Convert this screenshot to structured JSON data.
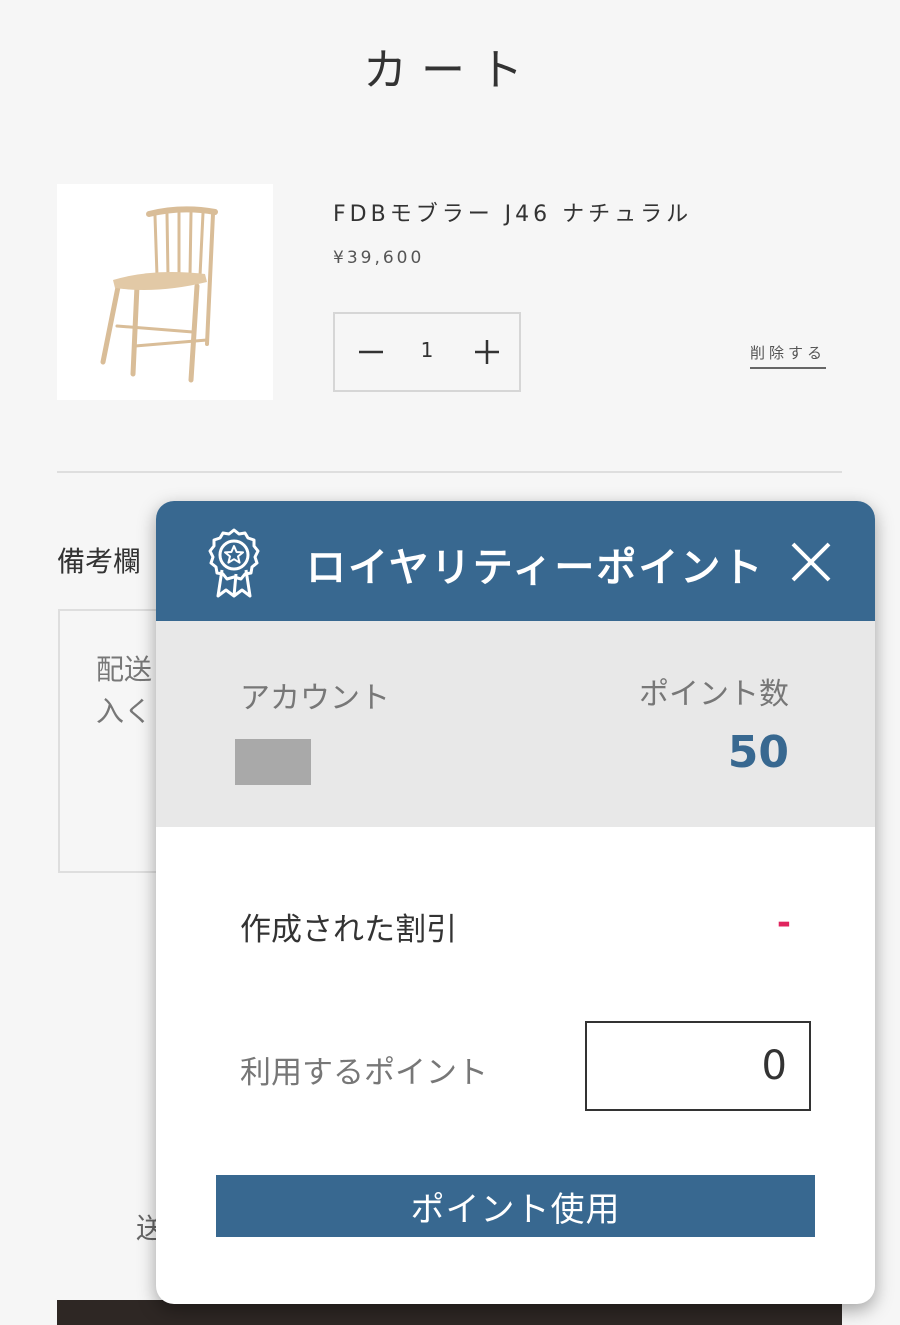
{
  "page": {
    "title": "カート"
  },
  "cart_item": {
    "name": "FDBモブラー J46 ナチュラル",
    "price": "¥39,600",
    "quantity": "1",
    "remove_label": "削除する",
    "image_icon": "chair-image"
  },
  "notes": {
    "label": "備考欄",
    "placeholder": "配送\n入く"
  },
  "behind_text": "送",
  "loyalty_popup": {
    "title": "ロイヤリティーポイント",
    "account_label": "アカウント",
    "points_label": "ポイント数",
    "points_value": "50",
    "discount_label": "作成された割引",
    "discount_value": "-",
    "use_points_label": "利用するポイント",
    "use_points_value": "0",
    "apply_button": "ポイント使用",
    "colors": {
      "header": "#386890",
      "accent_red": "#e0245e"
    }
  }
}
